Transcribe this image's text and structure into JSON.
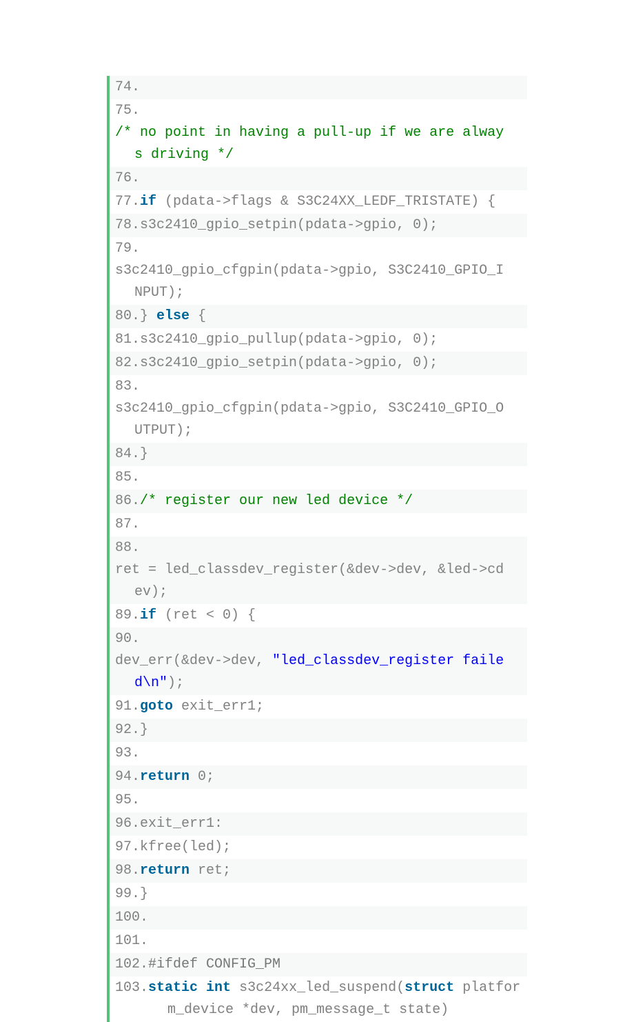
{
  "code": {
    "lines": [
      {
        "shaded": true,
        "number": "74.",
        "segments": []
      },
      {
        "shaded": false,
        "number": "75.",
        "segments": [
          {
            "cls": "t-comment",
            "text": "/* no point in having a pull-up if we are alway"
          }
        ],
        "wrap": [
          {
            "cls": "t-comment",
            "text": "s driving */"
          }
        ]
      },
      {
        "shaded": true,
        "number": "76.",
        "segments": []
      },
      {
        "shaded": false,
        "number": "77.",
        "segments": [
          {
            "cls": "t-keyword",
            "text": "if"
          },
          {
            "cls": "t-default",
            "text": " (pdata->flags & S3C24XX_LEDF_TRISTATE) {"
          }
        ]
      },
      {
        "shaded": true,
        "number": "78.",
        "segments": [
          {
            "cls": "t-default",
            "text": "s3c2410_gpio_setpin(pdata->gpio, 0);"
          }
        ]
      },
      {
        "shaded": false,
        "number": "79.",
        "segments": [
          {
            "cls": "t-default",
            "text": "s3c2410_gpio_cfgpin(pdata->gpio, S3C2410_GPIO_I"
          }
        ],
        "wrap": [
          {
            "cls": "t-default",
            "text": "NPUT);"
          }
        ]
      },
      {
        "shaded": true,
        "number": "80.",
        "segments": [
          {
            "cls": "t-default",
            "text": "} "
          },
          {
            "cls": "t-keyword",
            "text": "else"
          },
          {
            "cls": "t-default",
            "text": " {"
          }
        ]
      },
      {
        "shaded": false,
        "number": "81.",
        "segments": [
          {
            "cls": "t-default",
            "text": "s3c2410_gpio_pullup(pdata->gpio, 0);"
          }
        ]
      },
      {
        "shaded": true,
        "number": "82.",
        "segments": [
          {
            "cls": "t-default",
            "text": "s3c2410_gpio_setpin(pdata->gpio, 0);"
          }
        ]
      },
      {
        "shaded": false,
        "number": "83.",
        "segments": [
          {
            "cls": "t-default",
            "text": "s3c2410_gpio_cfgpin(pdata->gpio, S3C2410_GPIO_O"
          }
        ],
        "wrap": [
          {
            "cls": "t-default",
            "text": "UTPUT);"
          }
        ]
      },
      {
        "shaded": true,
        "number": "84.",
        "segments": [
          {
            "cls": "t-default",
            "text": "}"
          }
        ]
      },
      {
        "shaded": false,
        "number": "85.",
        "segments": []
      },
      {
        "shaded": true,
        "number": "86.",
        "segments": [
          {
            "cls": "t-comment",
            "text": "/* register our new led device */"
          }
        ]
      },
      {
        "shaded": false,
        "number": "87.",
        "segments": []
      },
      {
        "shaded": true,
        "number": "88.",
        "segments": [
          {
            "cls": "t-default",
            "text": "ret = led_classdev_register(&dev->dev, &led->cd"
          }
        ],
        "wrap": [
          {
            "cls": "t-default",
            "text": "ev);"
          }
        ]
      },
      {
        "shaded": false,
        "number": "89.",
        "segments": [
          {
            "cls": "t-keyword",
            "text": "if"
          },
          {
            "cls": "t-default",
            "text": " (ret < 0) {"
          }
        ]
      },
      {
        "shaded": true,
        "number": "90.",
        "segments": [
          {
            "cls": "t-default",
            "text": "dev_err(&dev->dev, "
          },
          {
            "cls": "t-string",
            "text": "\"led_classdev_register faile"
          }
        ],
        "wrap": [
          {
            "cls": "t-string",
            "text": "d\\n\""
          },
          {
            "cls": "t-default",
            "text": ");"
          }
        ]
      },
      {
        "shaded": false,
        "number": "91.",
        "segments": [
          {
            "cls": "t-keyword",
            "text": "goto"
          },
          {
            "cls": "t-default",
            "text": " exit_err1;"
          }
        ]
      },
      {
        "shaded": true,
        "number": "92.",
        "segments": [
          {
            "cls": "t-default",
            "text": "}"
          }
        ]
      },
      {
        "shaded": false,
        "number": "93.",
        "segments": []
      },
      {
        "shaded": true,
        "number": "94.",
        "segments": [
          {
            "cls": "t-keyword",
            "text": "return"
          },
          {
            "cls": "t-default",
            "text": " 0;"
          }
        ]
      },
      {
        "shaded": false,
        "number": "95.",
        "segments": []
      },
      {
        "shaded": true,
        "number": "96.",
        "segments": [
          {
            "cls": "t-default",
            "text": " exit_err1:"
          }
        ]
      },
      {
        "shaded": false,
        "number": "97.",
        "segments": [
          {
            "cls": "t-default",
            "text": "kfree(led);"
          }
        ]
      },
      {
        "shaded": true,
        "number": "98.",
        "segments": [
          {
            "cls": "t-keyword",
            "text": "return"
          },
          {
            "cls": "t-default",
            "text": " ret;"
          }
        ]
      },
      {
        "shaded": false,
        "number": "99.",
        "segments": [
          {
            "cls": "t-default",
            "text": "}"
          }
        ]
      },
      {
        "shaded": true,
        "number": "100.",
        "segments": []
      },
      {
        "shaded": false,
        "number": "101.",
        "segments": []
      },
      {
        "shaded": true,
        "number": "102.",
        "segments": [
          {
            "cls": "t-gray",
            "text": "  #ifdef CONFIG_PM"
          }
        ]
      },
      {
        "shaded": false,
        "number": "103.",
        "segments": [
          {
            "cls": "t-default",
            "text": "  "
          },
          {
            "cls": "t-keyword",
            "text": "static"
          },
          {
            "cls": "t-default",
            "text": " "
          },
          {
            "cls": "t-keyword",
            "text": "int"
          },
          {
            "cls": "t-default",
            "text": " s3c24xx_led_suspend("
          },
          {
            "cls": "t-keyword",
            "text": "struct"
          },
          {
            "cls": "t-default",
            "text": " platfor"
          }
        ],
        "wrap": [
          {
            "cls": "t-default",
            "text": "m_device *dev, pm_message_t state)"
          }
        ]
      }
    ]
  }
}
